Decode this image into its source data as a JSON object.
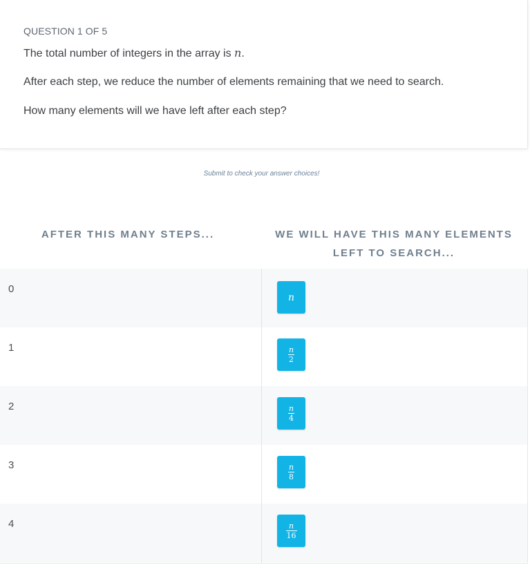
{
  "question": {
    "label": "QUESTION 1 OF 5",
    "line1_text": "The total number of integers in the array is ",
    "line1_var": "n",
    "line1_end": ".",
    "line2": "After each step, we reduce the number of elements remaining that we need to search.",
    "line3": "How many elements will we have left after each step?"
  },
  "submit_hint": "Submit to check your answer choices!",
  "table": {
    "left_header": "AFTER THIS MANY STEPS...",
    "right_header_line1": "WE WILL HAVE THIS MANY ELEMENTS",
    "right_header_line2": "LEFT TO SEARCH...",
    "rows": [
      {
        "step": "0",
        "answer_num": "n",
        "answer_den": ""
      },
      {
        "step": "1",
        "answer_num": "n",
        "answer_den": "2"
      },
      {
        "step": "2",
        "answer_num": "n",
        "answer_den": "4"
      },
      {
        "step": "3",
        "answer_num": "n",
        "answer_den": "8"
      },
      {
        "step": "4",
        "answer_num": "n",
        "answer_den": "16"
      }
    ]
  },
  "colors": {
    "tile": "#12b4e6",
    "row_shade": "#f7f8fa",
    "header_text": "#6f7f8d"
  }
}
